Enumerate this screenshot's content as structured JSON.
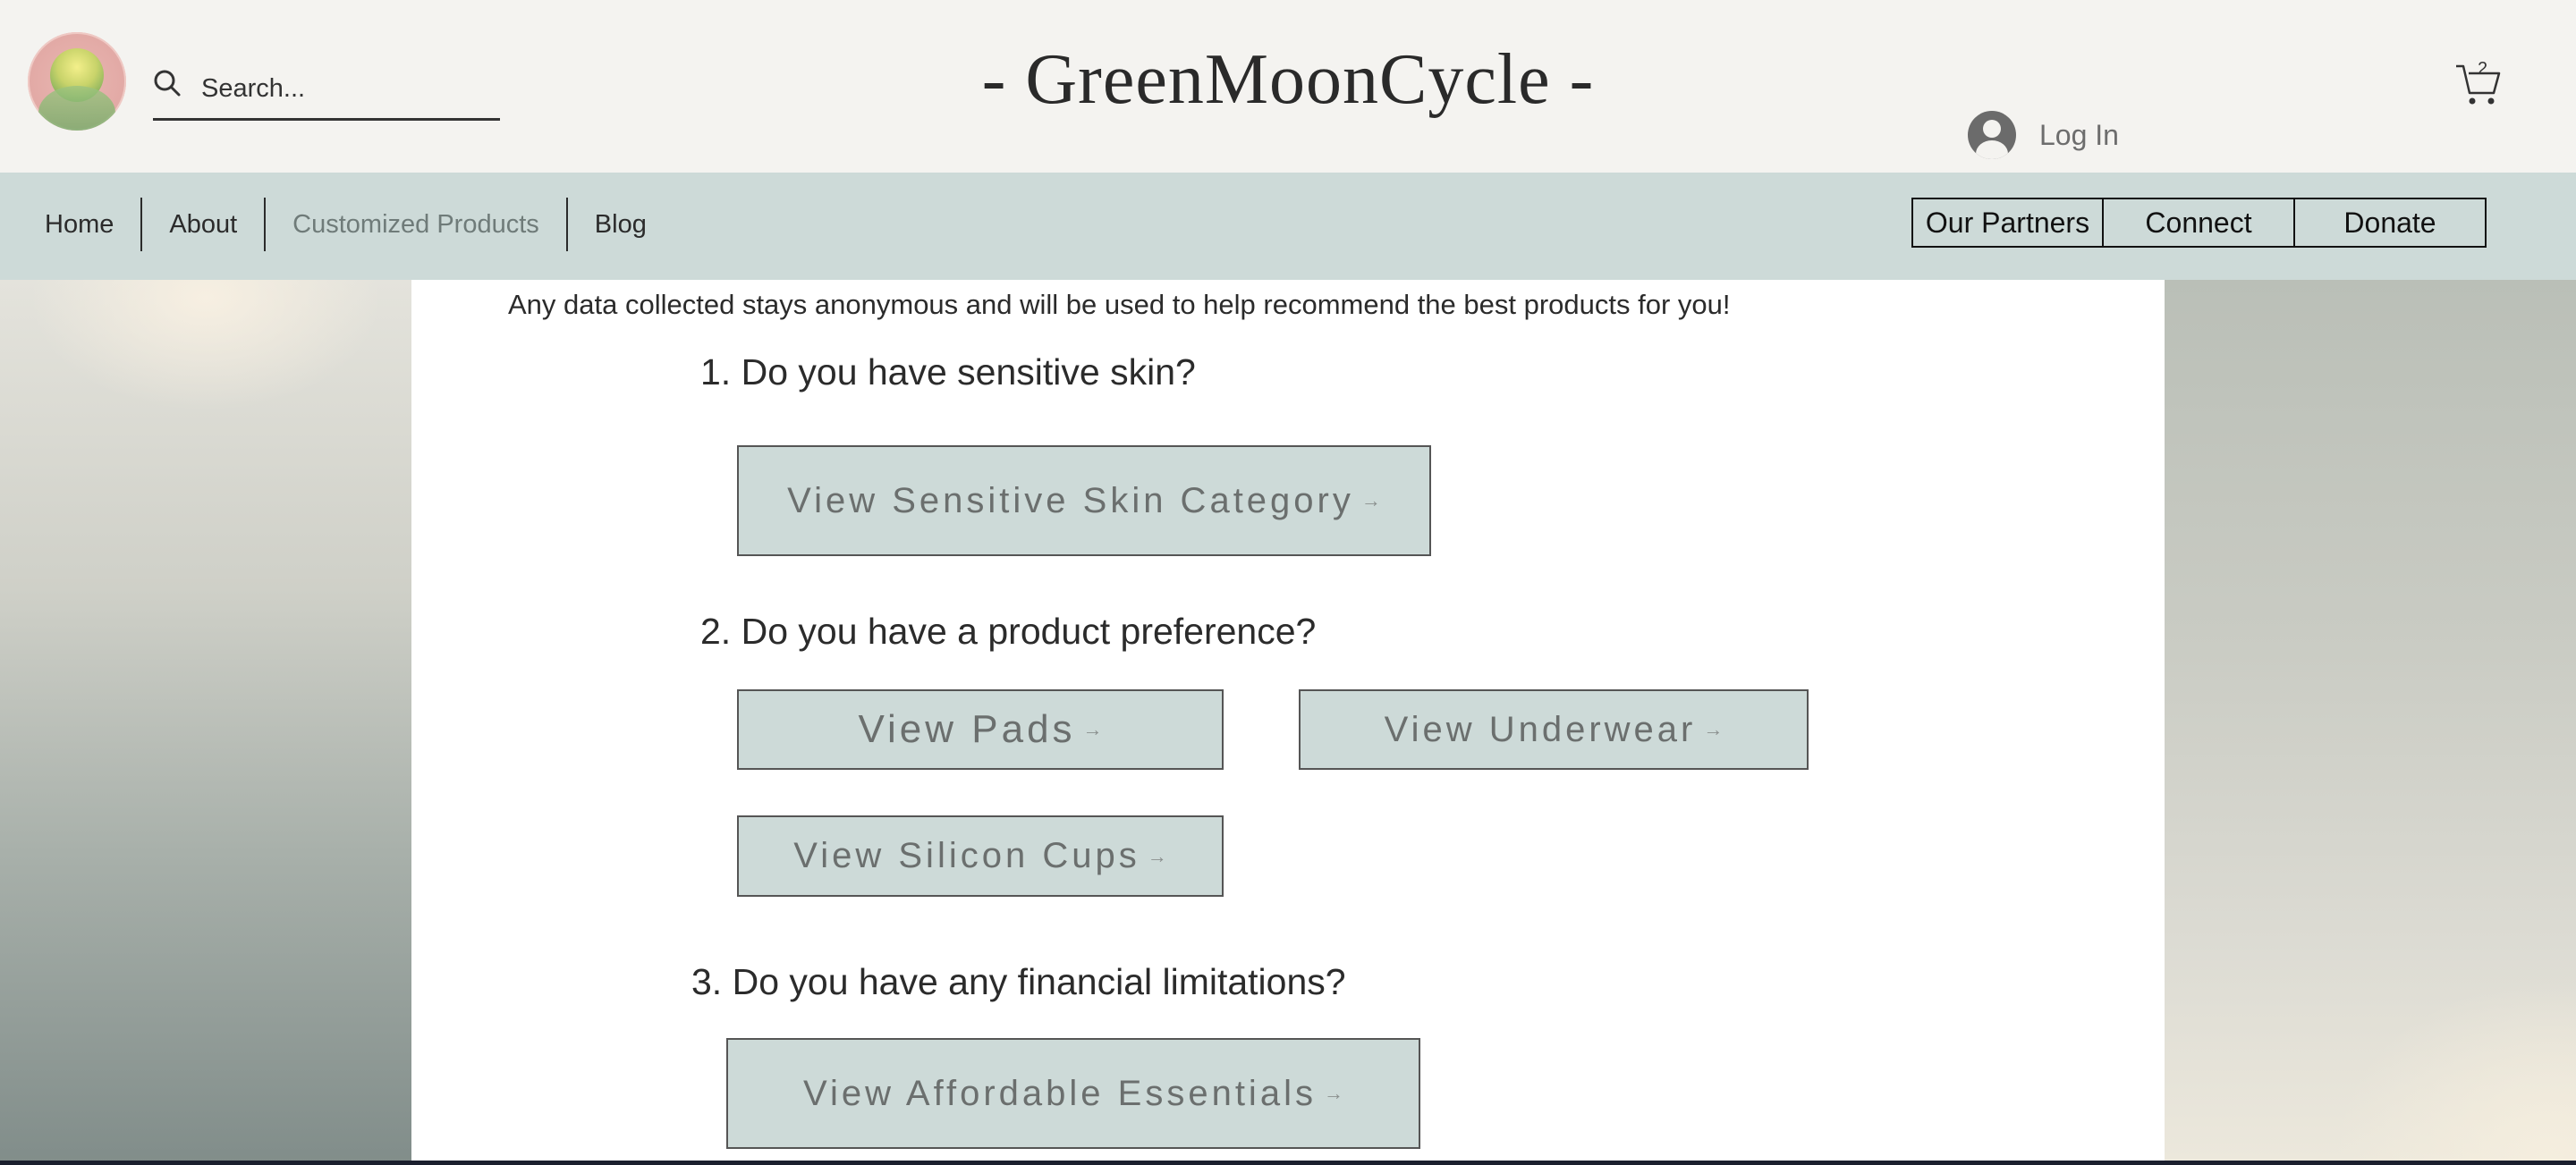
{
  "header": {
    "site_title": "- GreenMoonCycle -",
    "search_placeholder": "Search...",
    "login_label": "Log In",
    "cart_count": "2"
  },
  "nav": {
    "items": [
      {
        "label": "Home"
      },
      {
        "label": "About"
      },
      {
        "label": "Customized Products",
        "active": true
      },
      {
        "label": "Blog"
      }
    ],
    "buttons": [
      {
        "label": "Our Partners"
      },
      {
        "label": "Connect"
      },
      {
        "label": "Donate"
      }
    ]
  },
  "main": {
    "intro": "Any data collected stays anonymous and will be used to help recommend the best products for you!",
    "questions": [
      {
        "text": "1. Do you have sensitive skin?"
      },
      {
        "text": "2. Do you have a product preference?"
      },
      {
        "text": "3. Do you have any financial limitations?"
      }
    ],
    "buttons": {
      "sensitive": "View Sensitive Skin Category",
      "pads": "View Pads",
      "underwear": "View Underwear",
      "cups": "View Silicon Cups",
      "affordable": "View Affordable Essentials"
    },
    "arrow": "→"
  },
  "colors": {
    "nav_bg": "#cddad8",
    "header_bg": "#f4f3f0",
    "button_bg": "#cddad8"
  }
}
